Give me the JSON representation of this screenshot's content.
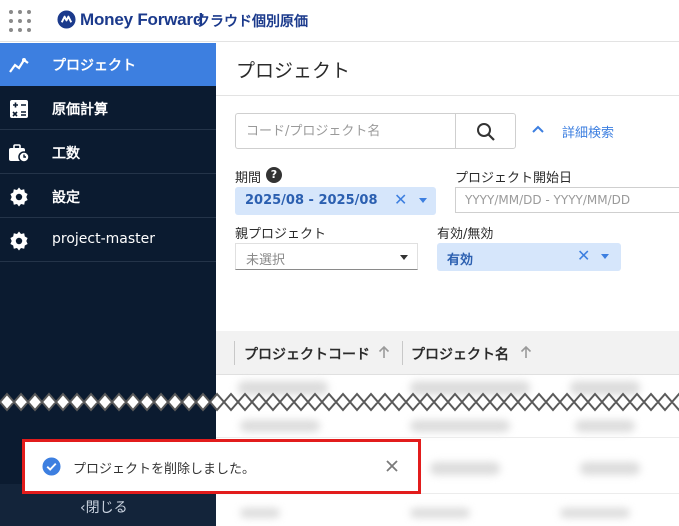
{
  "header": {
    "apps_icon": "apps-grid-icon",
    "brand_name": "Money Forward",
    "product_name": "クラウド個別原価",
    "brand_color": "#1b3a8c"
  },
  "sidebar": {
    "items": [
      {
        "label": "プロジェクト",
        "icon": "line-chart-icon",
        "active": true
      },
      {
        "label": "原価計算",
        "icon": "calculator-icon",
        "active": false
      },
      {
        "label": "工数",
        "icon": "briefcase-clock-icon",
        "active": false
      },
      {
        "label": "設定",
        "icon": "gear-icon",
        "active": false
      },
      {
        "label": "project-master",
        "icon": "gear-icon",
        "active": false
      }
    ],
    "close_label": "‹閉じる",
    "bg_color": "#0b1b30",
    "active_color": "#3d7fe0"
  },
  "main": {
    "page_title": "プロジェクト",
    "search": {
      "placeholder": "コード/プロジェクト名",
      "value": "",
      "button_icon": "search-icon"
    },
    "advanced_search_label": "詳細検索",
    "filters": {
      "period": {
        "label": "期間",
        "value": "2025/08 - 2025/08"
      },
      "start_date": {
        "label": "プロジェクト開始日",
        "placeholder": "YYYY/MM/DD - YYYY/MM/DD"
      },
      "parent_project": {
        "label": "親プロジェクト",
        "value": "未選択"
      },
      "valid": {
        "label": "有効/無効",
        "value": "有効"
      }
    },
    "table": {
      "columns": [
        "プロジェクトコード",
        "プロジェクト名"
      ]
    }
  },
  "toast": {
    "message": "プロジェクトを削除しました。",
    "icon": "check-circle-icon",
    "close_icon": "close-icon",
    "highlight_color": "#e21c1c"
  }
}
